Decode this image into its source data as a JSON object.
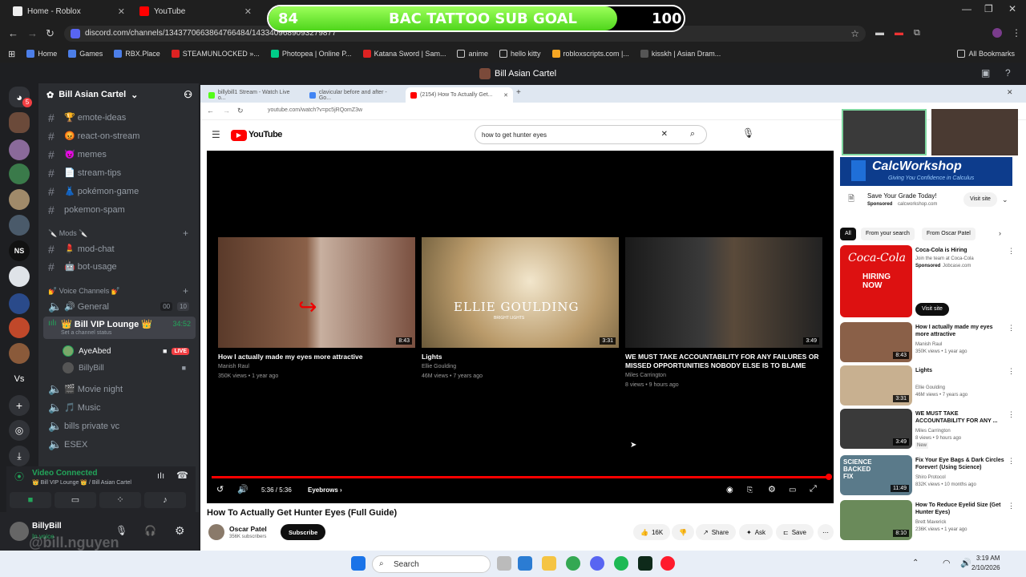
{
  "browser": {
    "tabs": [
      {
        "label": "Home - Roblox"
      },
      {
        "label": "YouTube"
      }
    ],
    "url": "discord.com/channels/1343770663864766484/1433409689093279877",
    "bookmarks": [
      "Home",
      "Games",
      "RBX.Place",
      "STEAMUNLOCKED »...",
      "Photopea | Online P...",
      "Katana Sword | Sam...",
      "anime",
      "hello kitty",
      "robloxscripts.com |...",
      "kisskh | Asian Dram..."
    ],
    "all_bookmarks": "All Bookmarks"
  },
  "goal": {
    "current": "84",
    "title": "BAC TATTOO SUB GOAL",
    "target": "100",
    "progress": 0.84
  },
  "discord": {
    "window_title": "Bill Asian Cartel",
    "server_name": "Bill Asian Cartel",
    "server_badge": "5",
    "srv_ns": "NS",
    "srv_vs": "Vs",
    "text_channels": [
      {
        "label": "🏆 emote-ideas"
      },
      {
        "label": "😡 react-on-stream"
      },
      {
        "label": "😈 memes"
      },
      {
        "label": "📄 stream-tips"
      },
      {
        "label": "👗 pokémon-game"
      },
      {
        "label": "pokemon-spam"
      }
    ],
    "mods_category": "🔪 Mods 🔪",
    "mod_channels": [
      {
        "label": "💄 mod-chat"
      },
      {
        "label": "🤖 bot-usage"
      }
    ],
    "voice_category": "💅 Voice Channels 💅",
    "general": {
      "label": "🔊 General",
      "count_a": "00",
      "count_b": "10"
    },
    "vip_lounge": {
      "label": "👑 Bill VIP Lounge 👑",
      "time": "34:52",
      "status": "Set a channel status"
    },
    "vip_users": [
      {
        "name": "AyeAbed",
        "live": "LIVE"
      },
      {
        "name": "BillyBill",
        "live": ""
      }
    ],
    "other_voice": [
      {
        "label": "🎬 Movie night"
      },
      {
        "label": "🎵 Music"
      },
      {
        "label": "bills private vc"
      },
      {
        "label": "ESEX"
      }
    ],
    "voice_status": "Video Connected",
    "voice_location": "👑 Bill VIP Lounge 👑 / Bill Asian Cartel",
    "user": {
      "name": "BillyBill",
      "status": "In voice"
    },
    "watermark": "@bill.nguyen"
  },
  "inner_browser": {
    "tabs": [
      {
        "label": "billybill1 Stream - Watch Live o..."
      },
      {
        "label": "clavicular before and after - Go..."
      },
      {
        "label": "(2154) How To Actually Get..."
      }
    ],
    "url": "youtube.com/watch?v=pc5jRQomZ3w"
  },
  "youtube": {
    "logo": "YouTube",
    "search_value": "how to get hunter eyes",
    "end_cards": [
      {
        "title": "How I actually made my eyes more attractive",
        "channel": "Manish Raul",
        "meta": "350K views • 1 year ago",
        "duration": "8:43"
      },
      {
        "title": "Lights",
        "channel": "Ellie Goulding",
        "meta": "46M views • 7 years ago",
        "duration": "3:31",
        "thumb_text": "ELLIE GOULDING",
        "thumb_sub": "BRIGHT LIGHTS"
      },
      {
        "title": "WE MUST TAKE ACCOUNTABILITY FOR ANY FAILURES OR MISSED OPPORTUNITIES NOBODY ELSE IS TO BLAME",
        "channel": "Miles Carrington",
        "meta": "8 views • 9 hours ago",
        "duration": "3:49"
      }
    ],
    "time": "5:36 / 5:36",
    "chapter": "Eyebrows ›",
    "video_title": "How To Actually Get Hunter Eyes (Full Guide)",
    "channel": {
      "name": "Oscar Patel",
      "subs": "356K subscribers",
      "subscribe": "Subscribe"
    },
    "actions": {
      "likes": "16K",
      "share": "Share",
      "ask": "Ask",
      "save": "Save"
    },
    "ad": {
      "banner_title": "CalcWorkshop",
      "banner_sub": "Giving You Confidence in Calculus",
      "title": "Save Your Grade Today!",
      "sponsored": "Sponsored",
      "domain": "calcworkshop.com",
      "visit": "Visit site"
    },
    "chips": [
      "All",
      "From your search",
      "From Oscar Patel"
    ],
    "promo": {
      "title": "Coca-Cola is Hiring",
      "sub": "Join the team at Coca-Cola",
      "sponsored": "Sponsored",
      "domain": "Jobcase.com",
      "visit": "Visit site",
      "thumb_brand": "Coca-Cola",
      "thumb_text": "HIRING NOW"
    },
    "related": [
      {
        "title": "How I actually made my eyes more attractive",
        "channel": "Manish Raul",
        "meta": "350K views • 1 year ago",
        "duration": "8:43",
        "badge": ""
      },
      {
        "title": "Lights",
        "channel": "Ellie Goulding",
        "meta": "46M views • 7 years ago",
        "duration": "3:31",
        "badge": ""
      },
      {
        "title": "WE MUST TAKE ACCOUNTABILITY FOR ANY ...",
        "channel": "Miles Carrington",
        "meta": "8 views • 9 hours ago",
        "duration": "3:49",
        "badge": "New"
      },
      {
        "title": "Fix Your Eye Bags & Dark Circles Forever! (Using Science)",
        "channel": "Shiro Protocol",
        "meta": "832K views • 10 months ago",
        "duration": "11:49",
        "badge": "",
        "thumb_text": "SCIENCE BACKED FIX"
      },
      {
        "title": "How To Reduce Eyelid Size (Get Hunter Eyes)",
        "channel": "Brett Maverick",
        "meta": "236K views • 1 year ago",
        "duration": "8:10",
        "badge": ""
      }
    ]
  },
  "taskbar": {
    "search": "Search",
    "time": "3:19 AM",
    "date": "2/10/2026"
  }
}
